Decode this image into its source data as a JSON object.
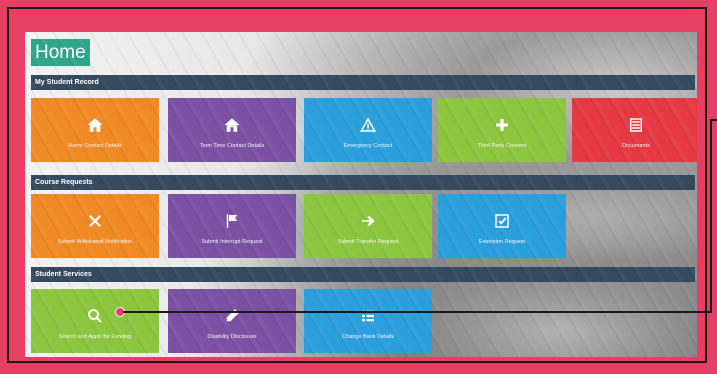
{
  "header": {
    "title": "Home"
  },
  "sections": [
    {
      "title": "My Student Record",
      "tiles": [
        {
          "label": "Home Contact Details",
          "icon": "home-icon",
          "color": "#f08a24"
        },
        {
          "label": "Term Time Contact Details",
          "icon": "home-icon",
          "color": "#7b51a3"
        },
        {
          "label": "Emergency Contact",
          "icon": "warning-icon",
          "color": "#2a9fdc"
        },
        {
          "label": "Third Party Consent",
          "icon": "plus-icon",
          "color": "#8cc63f"
        },
        {
          "label": "Documents",
          "icon": "document-icon",
          "color": "#e53943"
        }
      ]
    },
    {
      "title": "Course Requests",
      "tiles": [
        {
          "label": "Submit Withdrawal Notification",
          "icon": "x-icon",
          "color": "#f08a24"
        },
        {
          "label": "Submit Interrupt Request",
          "icon": "flag-icon",
          "color": "#7b51a3"
        },
        {
          "label": "Submit Transfer Request",
          "icon": "arrow-right-icon",
          "color": "#8cc63f"
        },
        {
          "label": "Extension Request",
          "icon": "check-icon",
          "color": "#2a9fdc"
        }
      ]
    },
    {
      "title": "Student Services",
      "tiles": [
        {
          "label": "Search and Apply for Funding",
          "icon": "search-icon",
          "color": "#8cc63f"
        },
        {
          "label": "Disability Disclosure",
          "icon": "pencil-icon",
          "color": "#7b51a3"
        },
        {
          "label": "Change Bank Details",
          "icon": "list-icon",
          "color": "#2a9fdc"
        }
      ]
    }
  ]
}
